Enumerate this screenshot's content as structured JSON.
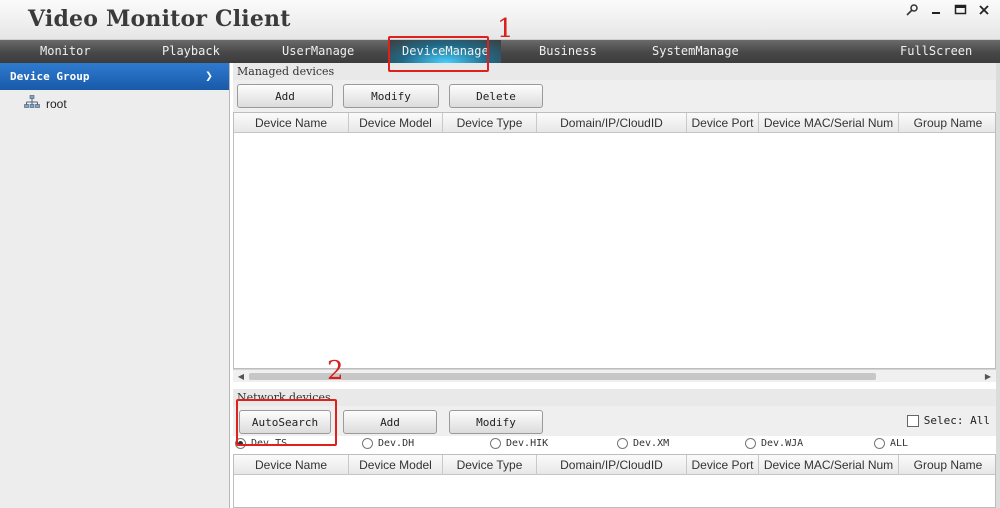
{
  "window": {
    "title": "Video Monitor Client",
    "controls": [
      "pin-icon",
      "minimize-icon",
      "maximize-icon",
      "close-icon"
    ]
  },
  "menu": {
    "items": [
      "Monitor",
      "Playback",
      "UserManage",
      "DeviceManage",
      "Business",
      "SystemManage",
      "FullScreen"
    ],
    "active": "DeviceManage"
  },
  "sidebar": {
    "header": "Device Group",
    "tree": [
      {
        "label": "root",
        "icon": "network-icon"
      }
    ]
  },
  "managed": {
    "label": "Managed devices",
    "buttons": {
      "add": "Add",
      "modify": "Modify",
      "delete": "Delete"
    },
    "columns": [
      "Device Name",
      "Device Model",
      "Device Type",
      "Domain/IP/CloudID",
      "Device Port",
      "Device MAC/Serial Num",
      "Group Name"
    ]
  },
  "network": {
    "label": "Network devices",
    "buttons": {
      "autosearch": "AutoSearch",
      "add": "Add",
      "modify": "Modify"
    },
    "select_all": "Selec: All",
    "filters": [
      "Dev.TS",
      "Dev.DH",
      "Dev.HIK",
      "Dev.XM",
      "Dev.WJA",
      "ALL"
    ],
    "filter_selected": "Dev.TS",
    "columns": [
      "Device Name",
      "Device Model",
      "Device Type",
      "Domain/IP/CloudID",
      "Device Port",
      "Device MAC/Serial Num",
      "Group Name"
    ]
  },
  "annotations": {
    "first": "1",
    "second": "2"
  },
  "colors": {
    "accent": "#1f6bc4",
    "annotation": "#e0201a",
    "menubar": "#474747"
  }
}
